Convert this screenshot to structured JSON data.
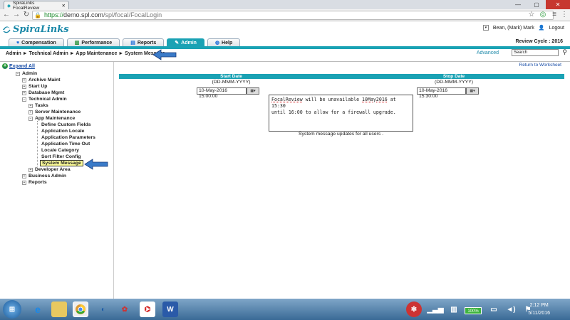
{
  "browser": {
    "tab_title": "SpiraLinks FocalReview",
    "url_scheme": "https://",
    "url_host": "demo.spl.com",
    "url_path": "/spl/focal/FocalLogin",
    "winbtn_min": "—",
    "winbtn_max": "▢",
    "winbtn_close": "✕"
  },
  "header": {
    "logo_text": "SpiraLinks",
    "user_name": "Bean, (Mark) Mark",
    "logout_label": "Logout",
    "review_cycle": "Review Cycle : 2016",
    "tabs": [
      {
        "label": "Compensation"
      },
      {
        "label": "Performance"
      },
      {
        "label": "Reports"
      },
      {
        "label": "Admin"
      },
      {
        "label": "Help"
      }
    ],
    "advanced_label": "Advanced",
    "search_value": "Search"
  },
  "breadcrumb": "Admin ► Technical Admin ► App Maintenance ► System Message",
  "sidebar": {
    "expand_all": "Expand All",
    "items": [
      {
        "label": "Admin"
      },
      {
        "label": "Archive Maint"
      },
      {
        "label": "Start Up"
      },
      {
        "label": "Database Mgmt"
      },
      {
        "label": "Technical Admin"
      },
      {
        "label": "Tasks"
      },
      {
        "label": "Server Maintenance"
      },
      {
        "label": "App Maintenance"
      },
      {
        "label": "Define Custom Fields"
      },
      {
        "label": "Application Locale"
      },
      {
        "label": "Application Parameters"
      },
      {
        "label": "Application Time Out"
      },
      {
        "label": "Locale Category"
      },
      {
        "label": "Sort Filter Config"
      },
      {
        "label": "System Message"
      },
      {
        "label": "Developer Area"
      },
      {
        "label": "Business Admin"
      },
      {
        "label": "Reports"
      }
    ]
  },
  "main": {
    "return_link": "Return to Worksheet",
    "start_date_header": "Start Date",
    "stop_date_header": "Stop Date",
    "date_format": "(DD-MMM-YYYY)",
    "start_date_value": "10-May-2016 15:00:00",
    "stop_date_value": "10-May-2016 15:30:00",
    "message_line1_a": "FocalReview",
    "message_line1_b": " will be unavailable ",
    "message_line1_c": "10May2016",
    "message_line1_d": " at 15:30",
    "message_line2": "until 16:00 to allow for a firewall upgrade.",
    "footnote": "System message updates for all users ."
  },
  "taskbar": {
    "time": "2:12 PM",
    "date": "5/11/2016",
    "battery": "100%"
  },
  "colors": {
    "teal": "#1aa2b4",
    "link": "#1a4fa8",
    "arrow": "#3a7ac8"
  }
}
